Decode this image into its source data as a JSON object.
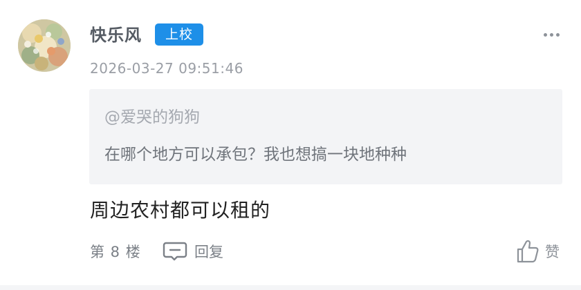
{
  "post": {
    "username": "快乐风",
    "rank_badge": "上校",
    "timestamp": "2026-03-27 09:51:46",
    "quote": {
      "user": "@爱哭的狗狗",
      "text": "在哪个地方可以承包？我也想搞一块地种种"
    },
    "content": "周边农村都可以租的",
    "floor": "第 8 楼",
    "reply_label": "回复",
    "like_label": "赞"
  },
  "icons": {
    "more": "more-dots-icon",
    "reply": "comment-bubble-icon",
    "like": "thumbs-up-icon"
  },
  "colors": {
    "badge": "#1e8fe8",
    "quote_background": "#f3f4f6",
    "secondary_text": "#9a9ea5"
  }
}
